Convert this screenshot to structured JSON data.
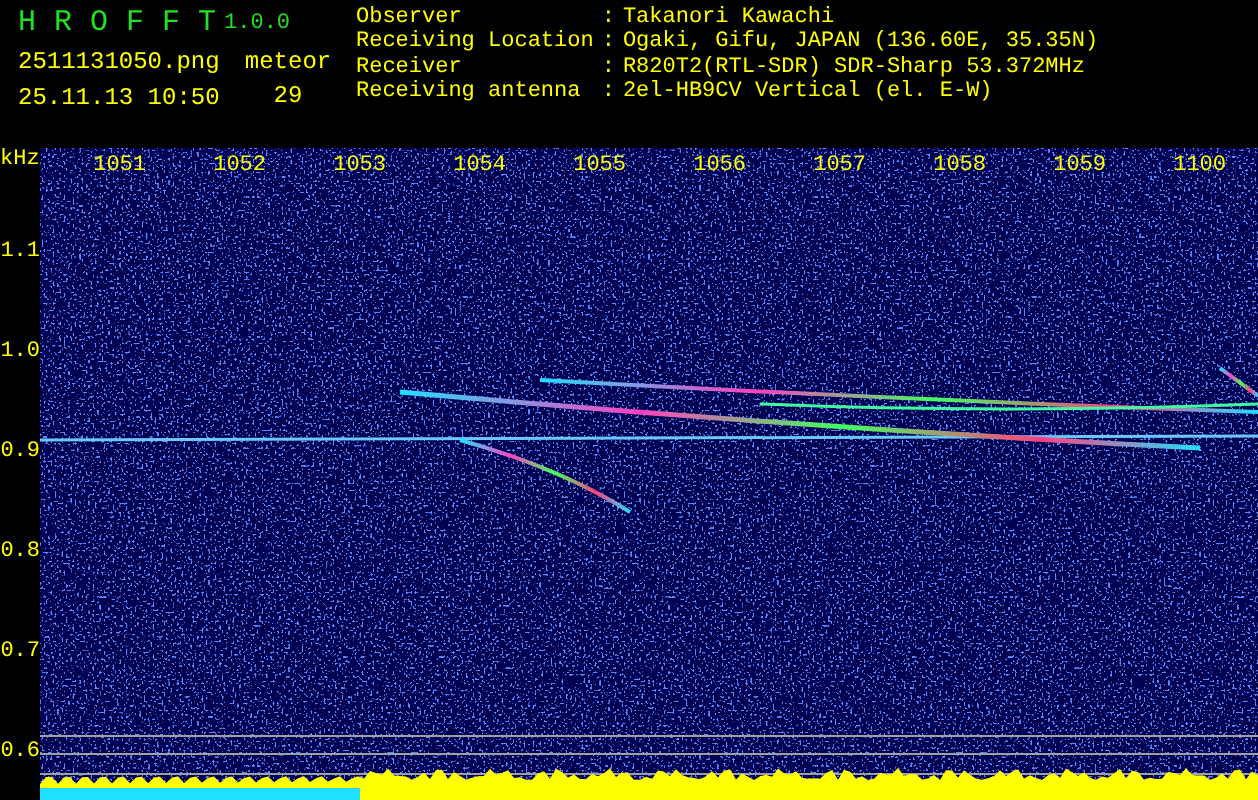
{
  "app": {
    "title": "H R O F F T",
    "version": "1.0.0"
  },
  "file": {
    "name": "2511131050.png",
    "datetime": "25.11.13 10:50"
  },
  "counter": {
    "label": "meteor",
    "value": "29"
  },
  "info": [
    {
      "label": "Observer",
      "separator": ":",
      "value": "Takanori Kawachi"
    },
    {
      "label": "Receiving Location",
      "separator": ":",
      "value": "Ogaki, Gifu, JAPAN (136.60E, 35.35N)"
    },
    {
      "label": "Receiver",
      "separator": ":",
      "value": "R820T2(RTL-SDR) SDR-Sharp 53.372MHz"
    },
    {
      "label": "Receiving antenna",
      "separator": ":",
      "value": "2el-HB9CV Vertical (el. E-W)"
    }
  ],
  "spectrogram": {
    "unit": "kHz",
    "x_labels": [
      "1051",
      "1052",
      "1053",
      "1054",
      "1055",
      "1056",
      "1057",
      "1058",
      "1059",
      "1100"
    ],
    "y_labels": [
      "1.1",
      "1.0",
      "0.9",
      "0.8",
      "0.7",
      "0.6"
    ]
  }
}
